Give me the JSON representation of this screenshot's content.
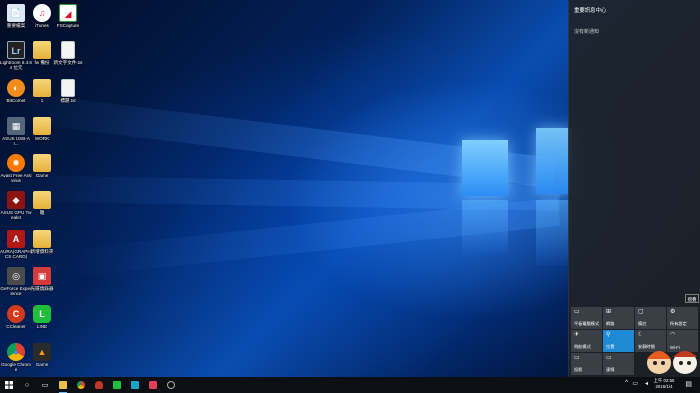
{
  "desktop": {
    "icons": [
      {
        "label": "重要檔案",
        "glyph": "📄",
        "color": "#d9e6f2"
      },
      {
        "label": "Lightroom 5.4.64 位元",
        "glyph": "Lr",
        "color": "#2b2b2b"
      },
      {
        "label": "BitComet",
        "glyph": "◐",
        "color": "#ef8a1b"
      },
      {
        "label": "ASUS USB-AI...",
        "glyph": "▦",
        "color": "#4a5a6a"
      },
      {
        "label": "Avast Free Antivirus",
        "glyph": "✸",
        "color": "#ff7a00"
      },
      {
        "label": "ASUS GPU TweakII",
        "glyph": "◆",
        "color": "#9a1010"
      },
      {
        "label": "AURA(GRAPHICS CARD)",
        "glyph": "A",
        "color": "#b01818"
      },
      {
        "label": "GeForce Experience",
        "glyph": "◎",
        "color": "#5a5a5a"
      },
      {
        "label": "CCleaner",
        "glyph": "C",
        "color": "#d23a1e"
      },
      {
        "label": "Google Chrome",
        "glyph": "●",
        "color": "#e2b52e"
      },
      {
        "label": "iTunes",
        "glyph": "♫",
        "color": "#ffffff"
      },
      {
        "label": "fw 備份",
        "glyph": "",
        "color": ""
      },
      {
        "label": "1",
        "glyph": "",
        "color": ""
      },
      {
        "label": "WORK",
        "glyph": "",
        "color": ""
      },
      {
        "label": "Game",
        "glyph": "",
        "color": ""
      },
      {
        "label": "雜",
        "glyph": "",
        "color": ""
      },
      {
        "label": "新增資料夾",
        "glyph": "",
        "color": ""
      },
      {
        "label": "光碟燒錄器",
        "glyph": "▣",
        "color": "#d63b3b"
      },
      {
        "label": "LINE",
        "glyph": "L",
        "color": "#1fbf3c"
      },
      {
        "label": "Game",
        "glyph": "▲",
        "color": "#2a2a2a"
      },
      {
        "label": "FSCapture",
        "glyph": "◢",
        "color": "#2a9a3a"
      },
      {
        "label": "新文字文件.txt",
        "glyph": "",
        "color": ""
      },
      {
        "label": "標題.txt",
        "glyph": "",
        "color": ""
      }
    ]
  },
  "action_center": {
    "title": "重要訊息中心",
    "empty_text": "沒有新通知",
    "collapse_label": "摺疊",
    "tiles": [
      {
        "label": "平板電腦模式",
        "icon": "▭",
        "active": false
      },
      {
        "label": "網路",
        "icon": "⊞",
        "active": false
      },
      {
        "label": "備註",
        "icon": "▢",
        "active": false
      },
      {
        "label": "所有設定",
        "icon": "⚙",
        "active": false
      },
      {
        "label": "飛航模式",
        "icon": "✈",
        "active": false
      },
      {
        "label": "位置",
        "icon": "⚲",
        "active": true
      },
      {
        "label": "安靜時間",
        "icon": "☾",
        "active": false
      },
      {
        "label": "Wi-Fi",
        "icon": "◠",
        "active": false
      },
      {
        "label": "投影",
        "icon": "▭",
        "active": false
      },
      {
        "label": "連線",
        "icon": "▭",
        "active": false
      }
    ]
  },
  "taskbar": {
    "start_icon": "start-icon",
    "clock_time": "上午 02:55",
    "clock_date": "2016/1/4"
  }
}
